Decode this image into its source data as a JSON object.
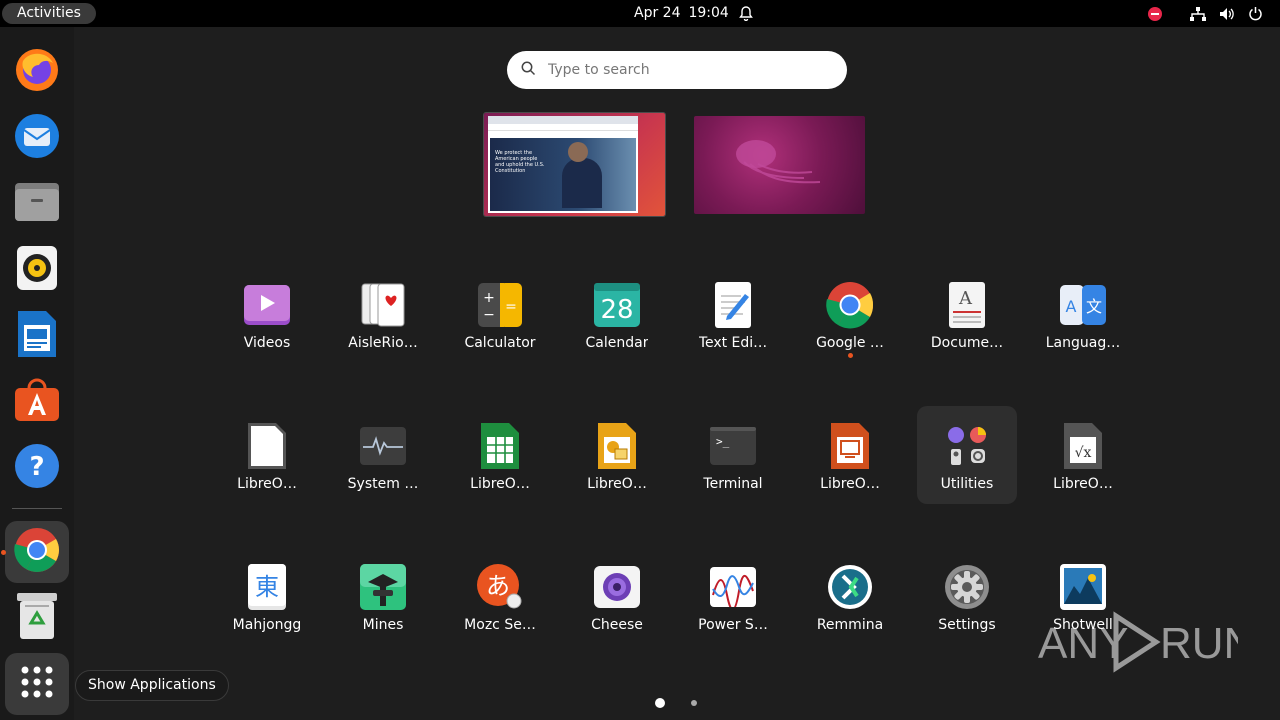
{
  "topbar": {
    "activities_label": "Activities",
    "date": "Apr 24",
    "time": "19:04",
    "icons": [
      "bell-icon",
      "do-not-disturb-icon",
      "network-icon",
      "volume-icon",
      "power-icon"
    ]
  },
  "dock": {
    "items": [
      {
        "name": "firefox",
        "icon": "firefox-icon"
      },
      {
        "name": "thunderbird",
        "icon": "thunderbird-icon"
      },
      {
        "name": "files",
        "icon": "files-icon"
      },
      {
        "name": "rhythmbox",
        "icon": "rhythmbox-icon"
      },
      {
        "name": "libreoffice-writer",
        "icon": "writer-icon"
      },
      {
        "name": "ubuntu-software",
        "icon": "software-icon"
      },
      {
        "name": "help",
        "icon": "help-icon"
      },
      {
        "name": "google-chrome",
        "icon": "chrome-icon",
        "active": true
      },
      {
        "name": "trash",
        "icon": "trash-icon"
      },
      {
        "name": "show-applications",
        "icon": "app-grid-icon",
        "active": true
      }
    ]
  },
  "search": {
    "placeholder": "Type to search"
  },
  "workspaces": {
    "browser_text": "We protect the American people and uphold the U.S. Constitution"
  },
  "apps": {
    "row1": [
      "Videos",
      "AisleRio…",
      "Calculator",
      "Calendar",
      "Text Edi…",
      "Google …",
      "Docume…",
      "Languag…"
    ],
    "row2": [
      "LibreO…",
      "System …",
      "LibreO…",
      "LibreO…",
      "Terminal",
      "LibreO…",
      "Utilities",
      "LibreO…"
    ],
    "row3": [
      "Mahjongg",
      "Mines",
      "Mozc Se…",
      "Cheese",
      "Power S…",
      "Remmina",
      "Settings",
      "Shotwell"
    ],
    "calendar_day": "28",
    "mahjongg_glyph": "東",
    "mozc_glyph": "あ",
    "terminal_prompt": ">_"
  },
  "tooltip": {
    "label": "Show Applications"
  },
  "pagination": {
    "current": 1,
    "total": 2
  },
  "watermark": {
    "text_left": "ANY",
    "text_right": "RUN"
  },
  "colors": {
    "accent": "#e95420",
    "topbar": "#000000",
    "background": "#1e1e1e"
  }
}
